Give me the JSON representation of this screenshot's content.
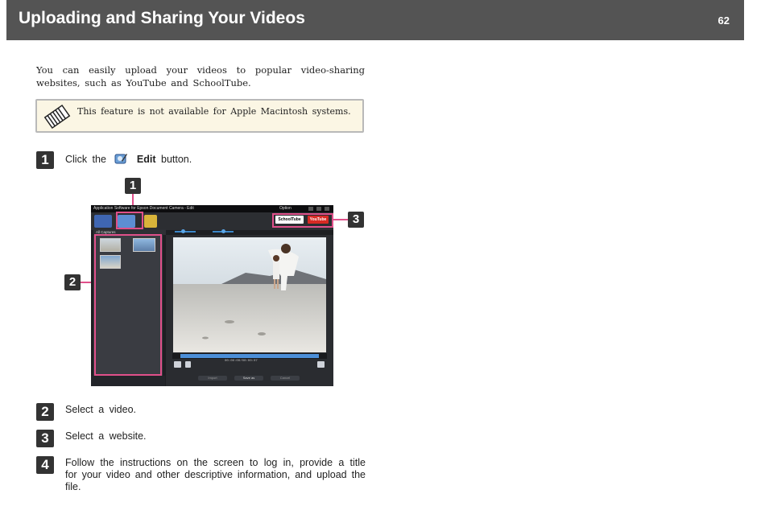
{
  "header": {
    "title": "Uploading and Sharing Your Videos",
    "page_number": "62"
  },
  "intro": "You can easily upload your videos to popular video-sharing websites, such as YouTube and SchoolTube.",
  "note": {
    "icon": "memo-pad-icon",
    "text": "This feature is not available for Apple Macintosh systems."
  },
  "steps": [
    {
      "number": "1",
      "before": "Click the",
      "bold": "Edit",
      "after": "button."
    },
    {
      "number": "2",
      "text": "Select a video."
    },
    {
      "number": "3",
      "text": "Select a website."
    },
    {
      "number": "4",
      "text": "Follow the instructions on the screen to log in, provide a title for your video and other descriptive information, and upload the file."
    }
  ],
  "callouts": [
    "1",
    "2",
    "3"
  ],
  "app": {
    "title": "Application Software for Epson Document Camera - Edit",
    "option_label": "Option",
    "caption_dropdown": "All Captures",
    "timecode": "00:00:00/00:00:07",
    "buttons": [
      "Import",
      "Save as",
      "Cancel"
    ],
    "share_buttons": [
      "SchoolTube",
      "YouTube"
    ],
    "colors": {
      "callout_outline": "#e0508a",
      "progress": "#4c8fd8"
    }
  }
}
